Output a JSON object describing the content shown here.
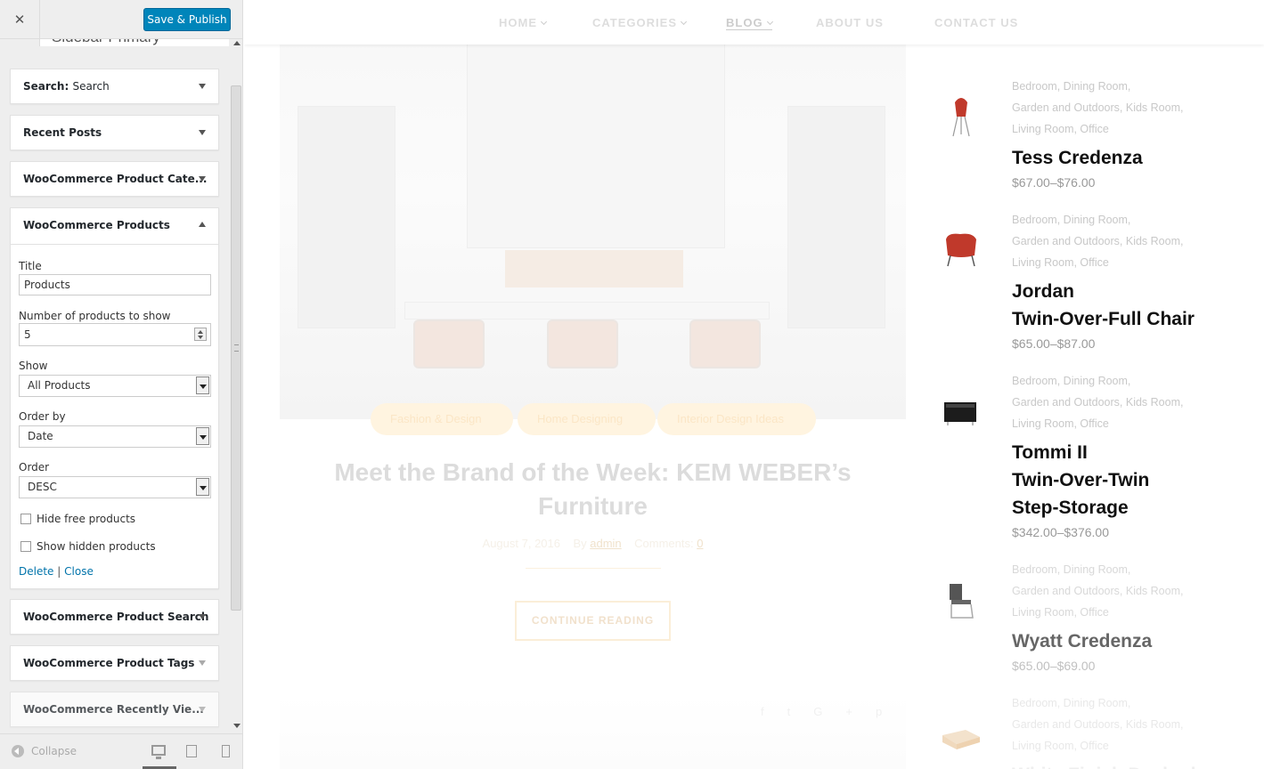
{
  "customizer": {
    "close_label": "✕",
    "save_label": "Save & Publish",
    "section_title": "Sidebar Primary",
    "widgets": [
      {
        "title": "Search:",
        "subtitle": "Search"
      },
      {
        "title": "Recent Posts"
      },
      {
        "title": "WooCommerce Product Cate..."
      },
      {
        "title": "WooCommerce Products",
        "expanded": true
      },
      {
        "title": "WooCommerce Product Search"
      },
      {
        "title": "WooCommerce Product Tags"
      },
      {
        "title": "WooCommerce Recently Vie..."
      }
    ],
    "form": {
      "title_label": "Title",
      "title_value": "Products",
      "number_label": "Number of products to show",
      "number_value": "5",
      "show_label": "Show",
      "show_value": "All Products",
      "orderby_label": "Order by",
      "orderby_value": "Date",
      "order_label": "Order",
      "order_value": "DESC",
      "hide_free_label": "Hide free products",
      "hide_free_checked": false,
      "show_hidden_label": "Show hidden products",
      "show_hidden_checked": false,
      "delete_label": "Delete",
      "separator": "|",
      "close_label": "Close"
    },
    "footer": {
      "collapse_label": "Collapse",
      "devices": [
        "desktop-icon",
        "tablet-icon",
        "mobile-icon"
      ],
      "selected_device": "desktop"
    }
  },
  "preview": {
    "nav": [
      "HOME",
      "CATEGORIES",
      "BLOG",
      "ABOUT US",
      "CONTACT US"
    ],
    "nav_active": "BLOG",
    "post": {
      "tags": [
        "Fashion & Design",
        "Home Designing",
        "Interior Design Ideas"
      ],
      "title": "Meet the Brand of the Week: KEM WEBER’s Furniture",
      "date": "August 7, 2016",
      "by_label": "By",
      "author": "admin",
      "comments_label": "Comments:",
      "comments": "0",
      "read_more": "CONTINUE READING",
      "social": [
        "f",
        "t",
        "G+",
        "p"
      ]
    },
    "products": [
      {
        "cats": [
          "Bedroom, Dining Room,",
          "Garden and Outdoors, Kids Room,",
          "Living Room, Office"
        ],
        "name": [
          "Tess Credenza"
        ],
        "price": "$67.00–$76.00",
        "thumb": "red-chair-icon"
      },
      {
        "cats": [
          "Bedroom, Dining Room,",
          "Garden and Outdoors, Kids Room,",
          "Living Room, Office"
        ],
        "name": [
          "Jordan",
          "Twin-Over-Full Chair"
        ],
        "price": "$65.00–$87.00",
        "thumb": "armchair-icon"
      },
      {
        "cats": [
          "Bedroom, Dining Room,",
          "Garden and Outdoors, Kids Room,",
          "Living Room, Office"
        ],
        "name": [
          "Tommi II",
          "Twin-Over-Twin",
          "Step-Storage"
        ],
        "price": "$342.00–$376.00",
        "thumb": "cabinet-icon"
      },
      {
        "cats": [
          "Bedroom, Dining Room,",
          "Garden and Outdoors, Kids Room,",
          "Living Room, Office"
        ],
        "name": [
          "Wyatt Credenza"
        ],
        "price": "$65.00–$69.00",
        "thumb": "metal-chair-icon"
      },
      {
        "cats": [
          "Bedroom, Dining Room,",
          "Garden and Outdoors, Kids Room,",
          "Living Room, Office"
        ],
        "name": [
          "White Finish Daybed"
        ],
        "price": "",
        "thumb": "bed-icon"
      }
    ]
  }
}
